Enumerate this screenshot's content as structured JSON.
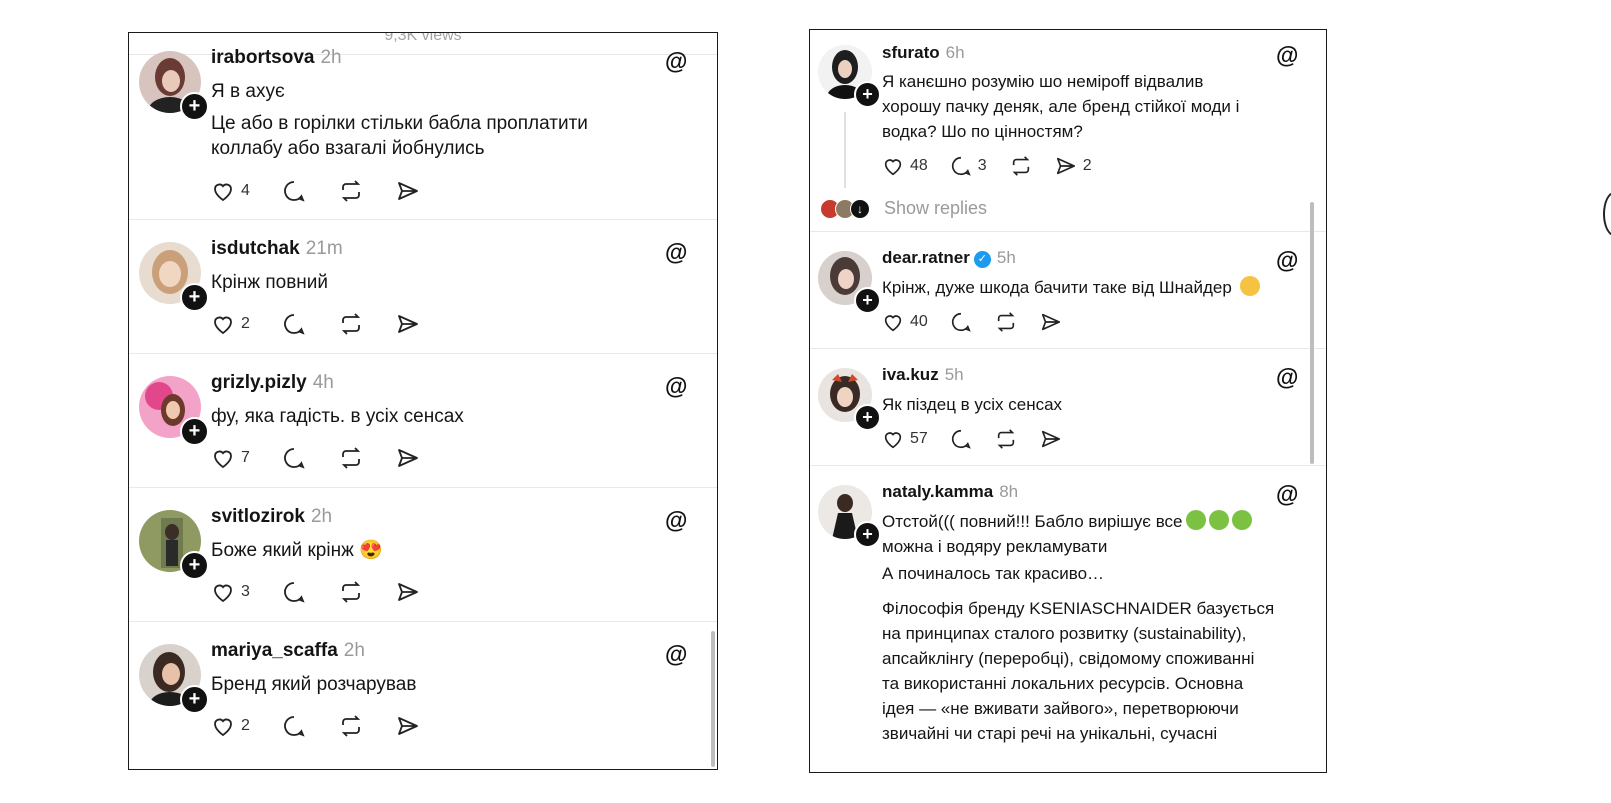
{
  "left": {
    "top_views": "9,3K views",
    "posts": [
      {
        "user": "irabortsova",
        "time": "2h",
        "lines": [
          "Я в ахує",
          "Це або в горілки стільки бабла проплатити",
          "коллабу або взагалі йобнулись"
        ],
        "likes": "4",
        "comments": "",
        "reposts": "",
        "shares": "",
        "avatar_color": "#6a3b35"
      },
      {
        "user": "isdutchak",
        "time": "21m",
        "lines": [
          "Крінж повний"
        ],
        "likes": "2",
        "comments": "",
        "reposts": "",
        "shares": "",
        "avatar_color": "#c9a07a"
      },
      {
        "user": "grizly.pizly",
        "time": "4h",
        "lines": [
          "фу, яка гадість. в усіх сенсах"
        ],
        "likes": "7",
        "comments": "",
        "reposts": "",
        "shares": "",
        "avatar_color": "#e2478c"
      },
      {
        "user": "svitlozirok",
        "time": "2h",
        "lines": [
          "Боже який крінж 😍"
        ],
        "likes": "3",
        "comments": "",
        "reposts": "",
        "shares": "",
        "avatar_color": "#6f7a4e"
      },
      {
        "user": "mariya_scaffa",
        "time": "2h",
        "lines": [
          "Бренд який розчарував"
        ],
        "likes": "2",
        "comments": "",
        "reposts": "",
        "shares": "",
        "avatar_color": "#8d6b5b"
      }
    ]
  },
  "right": {
    "posts": [
      {
        "user": "sfurato",
        "time": "6h",
        "lines": [
          "Я канєшно розумію шо неміроff відвалив",
          "хорошу пачку деняк, але бренд стійкої моди і",
          "водка? Шо по цінностям?"
        ],
        "likes": "48",
        "comments": "3",
        "reposts": "",
        "shares": "2",
        "avatar_color": "#2b2b2b"
      },
      {
        "user": "dear.ratner",
        "time": "5h",
        "lines": [
          "Крінж, дуже шкода бачити таке від Шнайдер"
        ],
        "likes": "40",
        "comments": "",
        "reposts": "",
        "shares": "",
        "avatar_color": "#4a3a38"
      },
      {
        "user": "iva.kuz",
        "time": "5h",
        "lines": [
          "Як піздец в усіх сенсах"
        ],
        "likes": "57",
        "comments": "",
        "reposts": "",
        "shares": "",
        "avatar_color": "#3a2a25"
      },
      {
        "user": "nataly.kamma",
        "time": "8h",
        "lines": [
          "Отстой((( повний!!! Бабло вирішує все",
          "можна і водяру рекламувати",
          "А починалось так красиво…"
        ],
        "paragraph": [
          " Філософія бренду KSENIASCHNAIDER базується",
          "на принципах сталого розвитку (sustainability),",
          "апсайклінгу (переробці), свідомому споживанні",
          "та використанні локальних ресурсів. Основна",
          "ідея — «не вживати зайвого», перетворюючи",
          "звичайні чи старі речі на унікальні, сучасні"
        ],
        "avatar_color": "#5a4a42"
      }
    ],
    "show_replies": "Show replies"
  },
  "icons": {
    "like": "heart-icon",
    "comment": "comment-icon",
    "repost": "repost-icon",
    "share": "share-icon",
    "threads": "threads-icon",
    "follow": "plus-icon",
    "verified": "verified-badge-icon"
  },
  "colors": {
    "text": "#141414",
    "muted": "#9a9a9a",
    "verified": "#1d9bf0",
    "divider": "#e9e9e9"
  }
}
